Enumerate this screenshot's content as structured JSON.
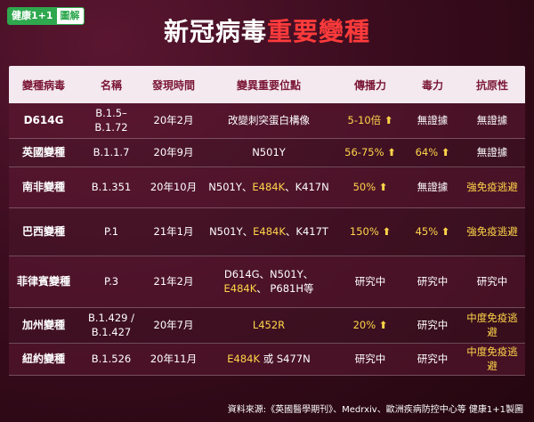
{
  "brand": {
    "part1": "健康1+1",
    "part2": "圖解"
  },
  "title": {
    "main": "新冠病毒",
    "highlight": "重要變種"
  },
  "headers": [
    "變種病毒",
    "名稱",
    "發現時間",
    "變異重要位點",
    "傳播力",
    "毒力",
    "抗原性"
  ],
  "rows": [
    {
      "virus": "D614G",
      "name": "B.1.5–\nB.1.72",
      "time": "20年2月",
      "mut": "改變刺突蛋白構像",
      "spread": "5-10倍",
      "spread_up": true,
      "vir": "無證據",
      "vir_up": false,
      "anti": "無證據"
    },
    {
      "virus": "英國變種",
      "name": "B.1.1.7",
      "time": "20年9月",
      "mut": "N501Y",
      "spread": "56-75%",
      "spread_up": true,
      "vir": "64%",
      "vir_up": true,
      "anti": "無證據"
    },
    {
      "virus": "南非變種",
      "name": "B.1.351",
      "time": "20年10月",
      "mut_a": "N501Y、",
      "mut_b": "E484K",
      "mut_c": "、K417N",
      "spread": "50%",
      "spread_up": true,
      "vir": "無證據",
      "vir_up": false,
      "anti": "強免疫逃避"
    },
    {
      "virus": "巴西變種",
      "name": "P.1",
      "time": "21年1月",
      "mut_a": "N501Y、",
      "mut_b": "E484K",
      "mut_c": "、K417T",
      "spread": "150%",
      "spread_up": true,
      "vir": "45%",
      "vir_up": true,
      "anti": "強免疫逃避"
    },
    {
      "virus": "菲律賓變種",
      "name": "P.3",
      "time": "21年2月",
      "mut_a": "D614G、N501Y、",
      "mut_b": "E484K",
      "mut_c": "、 P681H等",
      "spread": "研究中",
      "spread_up": false,
      "vir": "研究中",
      "vir_up": false,
      "anti": "研究中"
    },
    {
      "virus": "加州變種",
      "name": "B.1.429 /\nB.1.427",
      "time": "20年7月",
      "mut": "L452R",
      "spread": "20%",
      "spread_up": true,
      "vir": "研究中",
      "vir_up": false,
      "anti": "中度免疫逃避"
    },
    {
      "virus": "紐約變種",
      "name": "B.1.526",
      "time": "20年11月",
      "mut_b": "E484K",
      "mut_c": " 或 S477N",
      "spread": "研究中",
      "spread_up": false,
      "vir": "研究中",
      "vir_up": false,
      "anti": "中度免疫逃避"
    }
  ],
  "source": "資料來源:《英國醫學期刊》、Medrxiv、歐洲疾病防控中心等  健康1+1製圖",
  "arrow": "⬆"
}
